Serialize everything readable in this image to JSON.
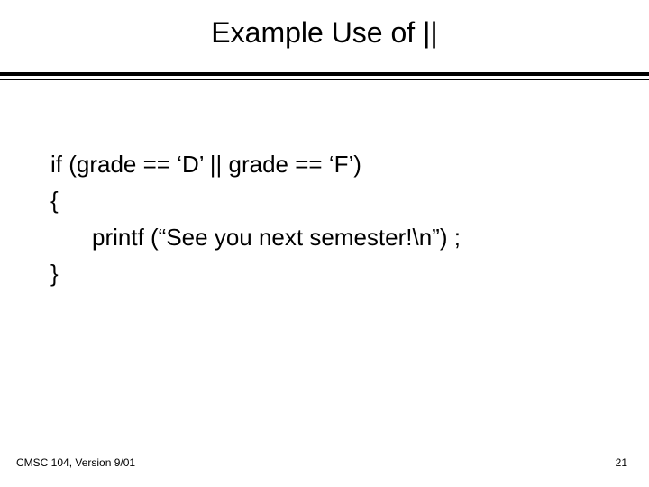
{
  "title": "Example Use of ||",
  "code": {
    "line1": "if (grade == ‘D’  ||  grade == ‘F’)",
    "line2": "{",
    "line3": "printf (“See you next semester!\\n”) ;",
    "line4": "}"
  },
  "footer": {
    "left": "CMSC 104, Version 9/01",
    "right": "21"
  }
}
